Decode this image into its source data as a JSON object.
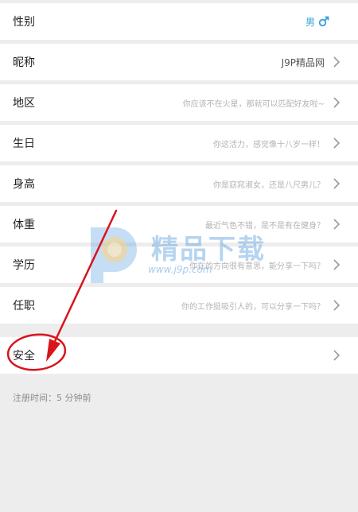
{
  "rows": [
    {
      "label": "性别",
      "value": "男",
      "value_style": "gender"
    },
    {
      "label": "昵称",
      "value": "J9P精品网",
      "value_style": "strong"
    },
    {
      "label": "地区",
      "value": "你应该不在火星，那就可以匹配好友啦~",
      "value_style": "hint"
    },
    {
      "label": "生日",
      "value": "你这活力，感觉像十八岁一样！",
      "value_style": "hint"
    },
    {
      "label": "身高",
      "value": "你是窈窕淑女，还是八尺男儿？",
      "value_style": "hint"
    },
    {
      "label": "体重",
      "value": "最近气色不错，是不是有在健身？",
      "value_style": "hint"
    },
    {
      "label": "学历",
      "value": "你在的方向很有意思，能分享一下吗？",
      "value_style": "hint"
    },
    {
      "label": "任职",
      "value": "你的工作挺吸引人的，可以分享一下吗？",
      "value_style": "hint"
    }
  ],
  "safety": {
    "label": "安全"
  },
  "registration": "注册时间：5 分钟前",
  "watermark": {
    "title": "精品下载",
    "url": "www.j9p.com"
  },
  "colors": {
    "accent": "#39a0d9",
    "annotation": "#d8141c"
  },
  "icons": {
    "gender": "male-icon",
    "row_arrow": "chevron-right-icon"
  }
}
